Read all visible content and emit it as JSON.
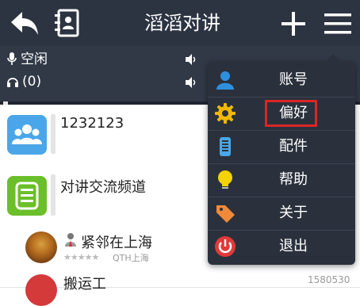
{
  "titlebar": {
    "title": "滔滔对讲"
  },
  "status": {
    "mic_label": "空闲",
    "headset_label": "(0)"
  },
  "channels": [
    {
      "name": "1232123"
    },
    {
      "name": "对讲交流频道"
    }
  ],
  "users": [
    {
      "name": "紧邻在上海",
      "rating": "★★★★★",
      "location": "QTH上海"
    },
    {
      "name": "搬运工",
      "extra": "1580530"
    }
  ],
  "menu": {
    "items": [
      {
        "label": "账号",
        "icon": "user-icon",
        "color": "#2f8fdd"
      },
      {
        "label": "偏好",
        "icon": "gear-icon",
        "color": "#f2b800"
      },
      {
        "label": "配件",
        "icon": "walkie-talkie-icon",
        "color": "#4aa6e8"
      },
      {
        "label": "帮助",
        "icon": "lightbulb-icon",
        "color": "#f5d300"
      },
      {
        "label": "关于",
        "icon": "tag-icon",
        "color": "#f08a3a"
      },
      {
        "label": "退出",
        "icon": "power-icon",
        "color": "#e03a3a"
      }
    ],
    "highlighted": "偏好"
  }
}
